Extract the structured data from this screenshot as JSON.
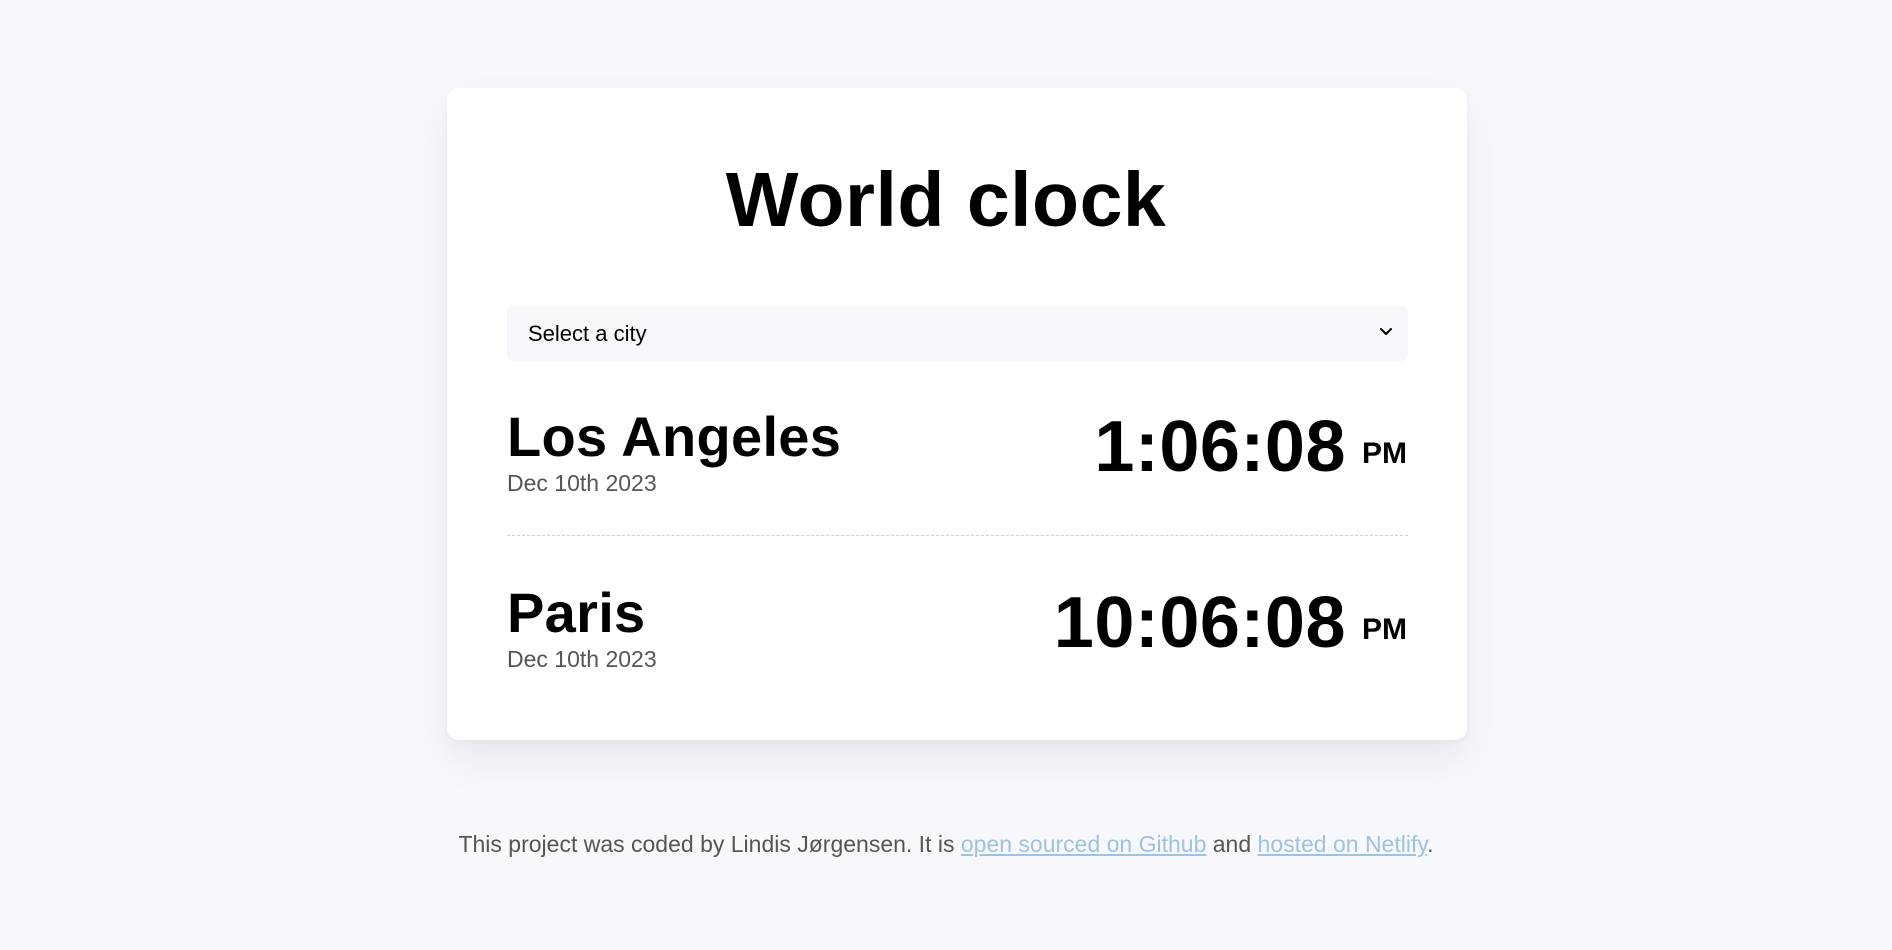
{
  "app": {
    "title": "World clock"
  },
  "city_select": {
    "selected": "Select a city"
  },
  "cities": [
    {
      "name": "Los Angeles",
      "date": "Dec 10th 2023",
      "time": "1:06:08",
      "ampm": "PM"
    },
    {
      "name": "Paris",
      "date": "Dec 10th 2023",
      "time": "10:06:08",
      "ampm": "PM"
    }
  ],
  "footer": {
    "text_before": "This project was coded by Lindis Jørgensen. It is ",
    "link_github": "open sourced on Github",
    "text_middle": " and ",
    "link_netlify": "hosted on Netlify",
    "text_after": "."
  },
  "colors": {
    "background": "#f8f8fc",
    "card": "#ffffff",
    "link": "#9cc3df",
    "muted_text": "#555555"
  },
  "icons": {
    "select_chevron": "chevron-down-icon"
  }
}
